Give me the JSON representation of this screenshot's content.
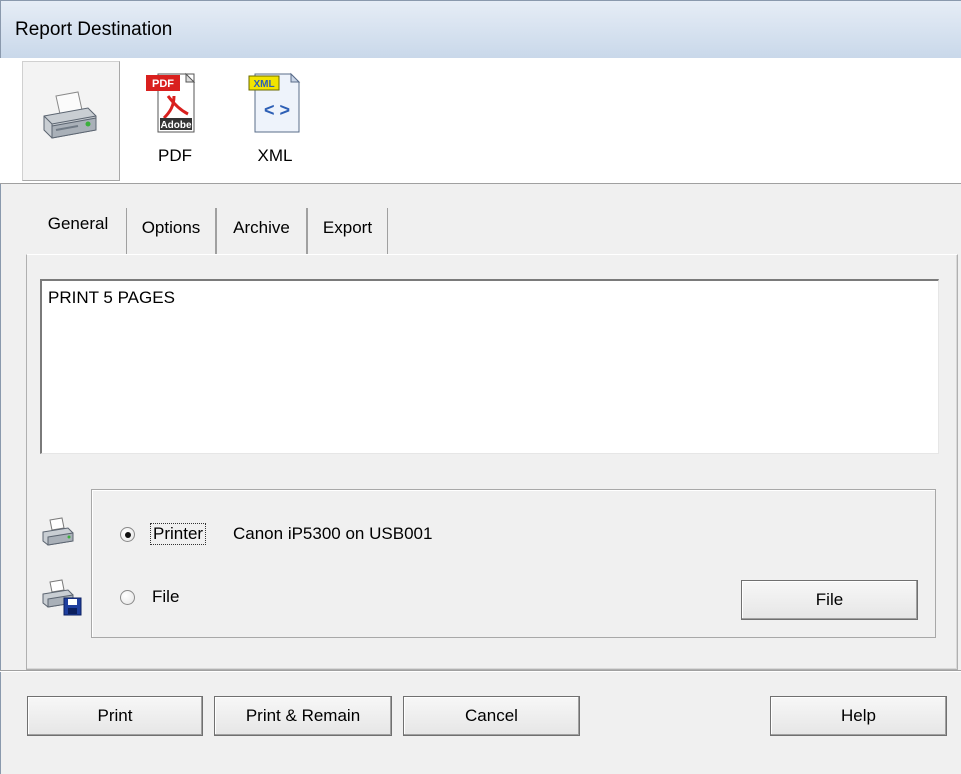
{
  "window": {
    "title": "Report Destination"
  },
  "destinations": [
    {
      "label": "",
      "icon": "printer-icon",
      "selected": true
    },
    {
      "label": "PDF",
      "icon": "pdf-file-icon",
      "badge": "PDF",
      "sub": "Adobe"
    },
    {
      "label": "XML",
      "icon": "xml-file-icon",
      "badge": "XML",
      "glyph": "< >"
    }
  ],
  "tabs": [
    "General",
    "Options",
    "Archive",
    "Export"
  ],
  "active_tab": "General",
  "general": {
    "text": "PRINT 5 PAGES",
    "printer_option": {
      "label": "Printer",
      "value": "Canon iP5300 on USB001",
      "checked": true
    },
    "file_option": {
      "label": "File",
      "checked": false
    },
    "file_button": "File"
  },
  "buttons": {
    "print": "Print",
    "print_remain": "Print & Remain",
    "cancel": "Cancel",
    "help": "Help"
  },
  "colors": {
    "pdf_red": "#d9201e",
    "xml_yellow": "#f2e400",
    "xml_blue": "#2d5fb5"
  }
}
